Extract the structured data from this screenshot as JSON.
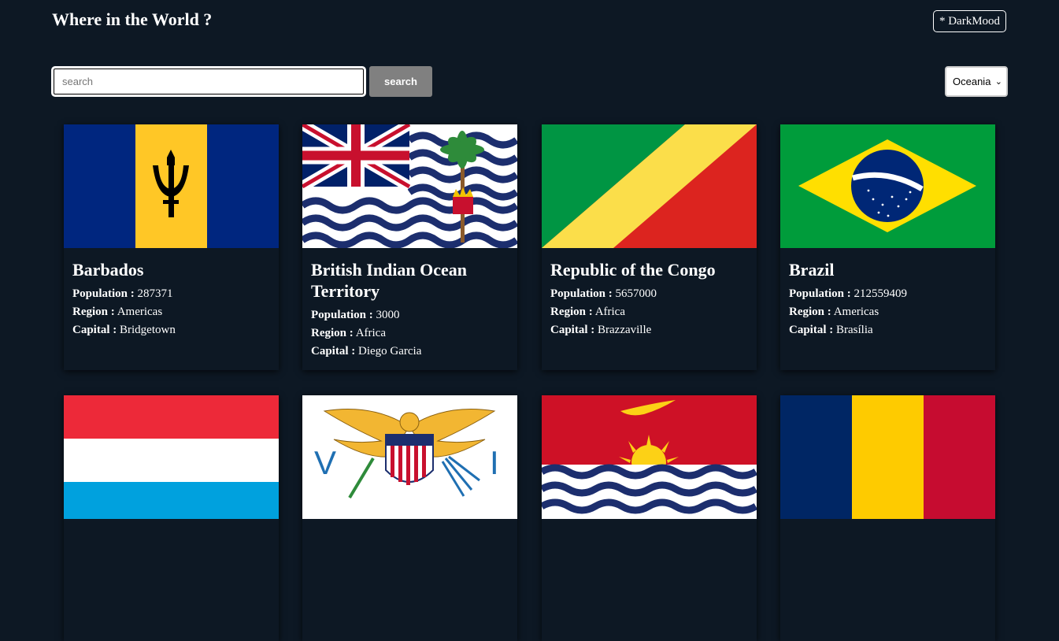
{
  "header": {
    "title": "Where in the World ?",
    "mode_label": "* DarkMood"
  },
  "search": {
    "placeholder": "search",
    "value": "",
    "button_label": "search"
  },
  "filter": {
    "selected": "Oceania"
  },
  "labels": {
    "population": "Population :",
    "region": "Region :",
    "capital": "Capital :"
  },
  "countries": [
    {
      "name": "Barbados",
      "population": "287371",
      "region": "Americas",
      "capital": "Bridgetown",
      "flag": "barbados-flag"
    },
    {
      "name": "British Indian Ocean Territory",
      "population": "3000",
      "region": "Africa",
      "capital": "Diego Garcia",
      "flag": "biot-flag"
    },
    {
      "name": "Republic of the Congo",
      "population": "5657000",
      "region": "Africa",
      "capital": "Brazzaville",
      "flag": "congo-flag"
    },
    {
      "name": "Brazil",
      "population": "212559409",
      "region": "Americas",
      "capital": "Brasília",
      "flag": "brazil-flag"
    },
    {
      "name": "",
      "flag": "luxembourg-flag"
    },
    {
      "name": "",
      "flag": "us-virgin-islands-flag"
    },
    {
      "name": "",
      "flag": "kiribati-flag"
    },
    {
      "name": "",
      "flag": "chad-flag"
    }
  ]
}
